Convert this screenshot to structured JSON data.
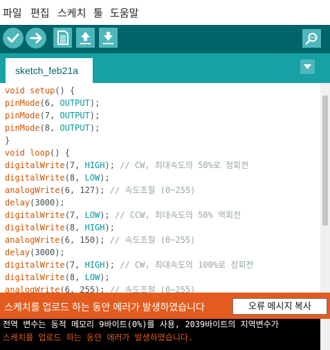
{
  "menu": {
    "items": [
      "파일",
      "편집",
      "스케치",
      "툴",
      "도움말"
    ]
  },
  "toolbar": {
    "buttons": [
      "check-icon",
      "arrow-right-icon",
      "new-file-icon",
      "open-icon",
      "save-icon"
    ],
    "monitor": "magnifier-icon"
  },
  "tabs": {
    "active": "sketch_feb21a",
    "menu_icon": "triangle-down-icon"
  },
  "colors": {
    "toolbar": "#006468",
    "tabstrip": "#17a1a5",
    "button": "#4db7bb",
    "keyword": "#d35400",
    "constant": "#00979c",
    "comment": "#95a5a6",
    "error_bar": "#e35b1e",
    "console_error": "#e35b1e"
  },
  "code_lines": [
    [
      [
        "k",
        "void"
      ],
      [
        "t",
        " "
      ],
      [
        "k",
        "setup"
      ],
      [
        "t",
        "() {"
      ]
    ],
    [
      [
        "k",
        "pinMode"
      ],
      [
        "t",
        "(6, "
      ],
      [
        "c",
        "OUTPUT"
      ],
      [
        "t",
        ");"
      ]
    ],
    [
      [
        "k",
        "pinMode"
      ],
      [
        "t",
        "(7, "
      ],
      [
        "c",
        "OUTPUT"
      ],
      [
        "t",
        ");"
      ]
    ],
    [
      [
        "k",
        "pinMode"
      ],
      [
        "t",
        "(8, "
      ],
      [
        "c",
        "OUTPUT"
      ],
      [
        "t",
        ");"
      ]
    ],
    [
      [
        "t",
        "}"
      ]
    ],
    [
      [
        "k",
        "void"
      ],
      [
        "t",
        " "
      ],
      [
        "k",
        "loop"
      ],
      [
        "t",
        "() {"
      ]
    ],
    [
      [
        "k",
        "digitalWrite"
      ],
      [
        "t",
        "(7, "
      ],
      [
        "c",
        "HIGH"
      ],
      [
        "t",
        ");"
      ],
      [
        "m",
        " // CW, 최대속도의 50%로 정회전"
      ]
    ],
    [
      [
        "k",
        "digitalWrite"
      ],
      [
        "t",
        "(8, "
      ],
      [
        "c",
        "LOW"
      ],
      [
        "t",
        ");"
      ]
    ],
    [
      [
        "k",
        "analogWrite"
      ],
      [
        "t",
        "(6, 127);"
      ],
      [
        "m",
        " // 속도조절 (0~255)"
      ]
    ],
    [
      [
        "k",
        "delay"
      ],
      [
        "t",
        "(3000);"
      ]
    ],
    [
      [
        "k",
        "digitalWrite"
      ],
      [
        "t",
        "(7, "
      ],
      [
        "c",
        "LOW"
      ],
      [
        "t",
        ");"
      ],
      [
        "m",
        " // CCW, 최대속도의 50% 역회전"
      ]
    ],
    [
      [
        "k",
        "digitalWrite"
      ],
      [
        "t",
        "(8, "
      ],
      [
        "c",
        "HIGH"
      ],
      [
        "t",
        ");"
      ]
    ],
    [
      [
        "k",
        "analogWrite"
      ],
      [
        "t",
        "(6, 150);"
      ],
      [
        "m",
        " // 속도조절 (0~255)"
      ]
    ],
    [
      [
        "k",
        "delay"
      ],
      [
        "t",
        "(3000);"
      ]
    ],
    [
      [
        "k",
        "digitalWrite"
      ],
      [
        "t",
        "(7, "
      ],
      [
        "c",
        "HIGH"
      ],
      [
        "t",
        ");"
      ],
      [
        "m",
        " // CW, 최대속도의 100%로 정회전"
      ]
    ],
    [
      [
        "k",
        "digitalWrite"
      ],
      [
        "t",
        "(8, "
      ],
      [
        "c",
        "LOW"
      ],
      [
        "t",
        ");"
      ]
    ],
    [
      [
        "k",
        "analogWrite"
      ],
      [
        "t",
        "(6, 255);"
      ],
      [
        "m",
        " // 속도조절 (0~255)"
      ]
    ]
  ],
  "status": {
    "message": "스케치를 업로드 하는 동안 에러가 발생하였습니다",
    "copy_button": "오류 메시지 복사"
  },
  "console": {
    "lines": [
      {
        "text": "전역 변수는 동적 메모리 9바이트(0%)를 사용, 2039바이트의 지역변수가",
        "color": "#ffffff"
      },
      {
        "text": "스케치를 업로드 하는 동안 에러가 발생하였습니다.",
        "color": "#e35b1e"
      }
    ]
  }
}
